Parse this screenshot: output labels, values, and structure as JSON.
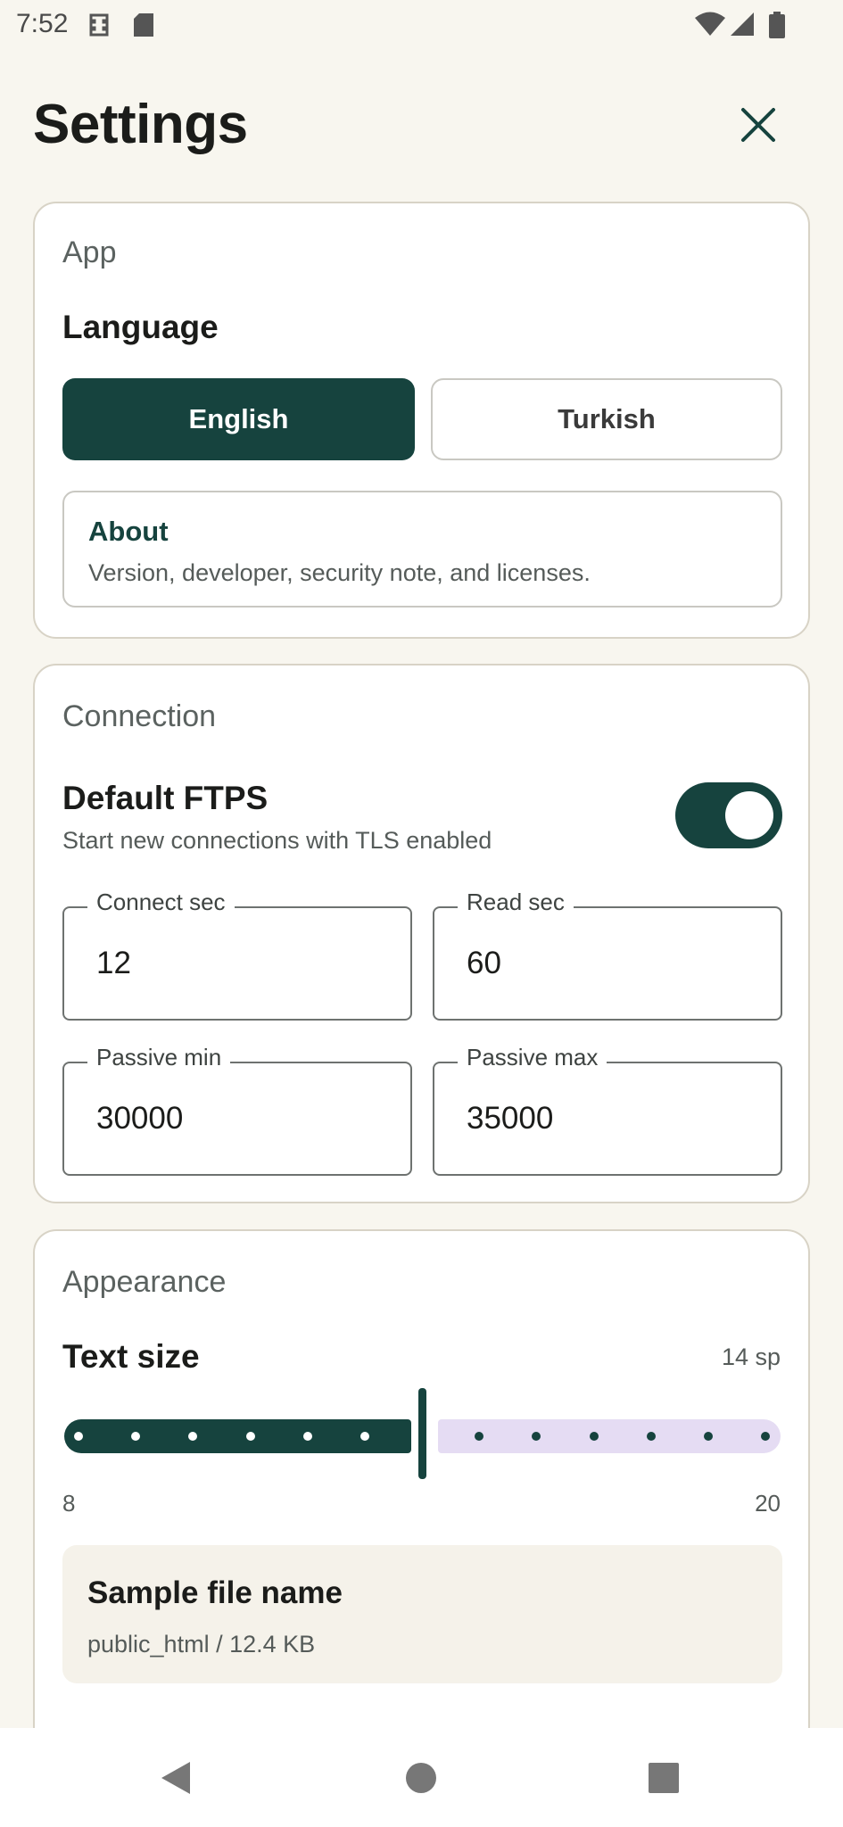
{
  "status_bar": {
    "time": "7:52",
    "icons": [
      "sim-icon",
      "sd-card-icon",
      "wifi-icon",
      "signal-icon",
      "battery-icon"
    ]
  },
  "header": {
    "title": "Settings",
    "close_icon": "close-icon"
  },
  "app_card": {
    "title": "App",
    "language_label": "Language",
    "languages": [
      {
        "label": "English",
        "selected": true
      },
      {
        "label": "Turkish",
        "selected": false
      }
    ],
    "about": {
      "title": "About",
      "description": "Version, developer, security note, and licenses."
    }
  },
  "connection_card": {
    "title": "Connection",
    "default_ftps": {
      "label": "Default FTPS",
      "description": "Start new connections with TLS enabled",
      "enabled": true
    },
    "fields": [
      {
        "label": "Connect sec",
        "value": "12"
      },
      {
        "label": "Read sec",
        "value": "60"
      },
      {
        "label": "Passive min",
        "value": "30000"
      },
      {
        "label": "Passive max",
        "value": "35000"
      }
    ]
  },
  "appearance_card": {
    "title": "Appearance",
    "text_size_label": "Text size",
    "text_size_value": "14 sp",
    "slider": {
      "min": 8,
      "max": 20,
      "value": 14,
      "step": 1
    },
    "min_label": "8",
    "max_label": "20",
    "sample": {
      "title": "Sample file name",
      "subtitle": "public_html / 12.4 KB"
    }
  },
  "colors": {
    "accent": "#16433e",
    "background": "#f8f6ef",
    "card": "#ffffff",
    "inactive_track": "#e5dcf3"
  },
  "nav_bar": {
    "icons": [
      "back-icon",
      "home-icon",
      "recents-icon"
    ]
  }
}
